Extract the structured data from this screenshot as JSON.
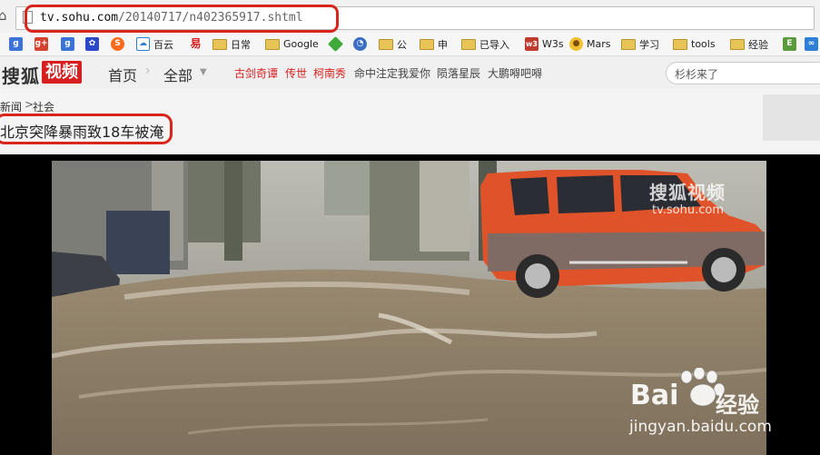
{
  "address_bar": {
    "url_host": "tv.sohu.com",
    "url_path": "/20140717/n402365917.shtml"
  },
  "bookmarks": [
    {
      "icon": "google-blue-icon",
      "label": ""
    },
    {
      "icon": "google-plus-icon",
      "label": ""
    },
    {
      "icon": "google-blue-icon",
      "label": ""
    },
    {
      "icon": "baidu-paw-icon",
      "label": ""
    },
    {
      "icon": "sogou-s-icon",
      "label": ""
    },
    {
      "icon": "baiyun-icon",
      "label": "百云"
    },
    {
      "icon": "yi-red-icon",
      "label": ""
    },
    {
      "icon": "folder-icon",
      "label": "日常"
    },
    {
      "icon": "folder-icon",
      "label": "Google"
    },
    {
      "icon": "green-diamond-icon",
      "label": ""
    },
    {
      "icon": "rss-icon",
      "label": ""
    },
    {
      "icon": "folder-icon",
      "label": "公"
    },
    {
      "icon": "folder-icon",
      "label": "申"
    },
    {
      "icon": "folder-icon",
      "label": "已导入"
    },
    {
      "icon": "w3-icon",
      "label": "W3s"
    },
    {
      "icon": "mars-icon",
      "label": "Mars"
    },
    {
      "icon": "folder-icon",
      "label": "学习"
    },
    {
      "icon": "folder-icon",
      "label": "tools"
    },
    {
      "icon": "folder-icon",
      "label": "经验"
    },
    {
      "icon": "evernote-icon",
      "label": ""
    },
    {
      "icon": "infinity-icon",
      "label": ""
    }
  ],
  "site_header": {
    "logo_text": "搜狐",
    "logo_badge": "视频",
    "nav_home": "首页",
    "nav_all": "全部",
    "hot_links": [
      {
        "text": "古剑奇谭",
        "color": "#d81e1e"
      },
      {
        "text": "传世",
        "color": "#d81e1e"
      },
      {
        "text": "柯南秀",
        "color": "#d81e1e"
      },
      {
        "text": "命中注定我爱你",
        "color": "#444444"
      },
      {
        "text": "陨落星辰",
        "color": "#444444"
      },
      {
        "text": "大鹏嘚吧嘚",
        "color": "#444444"
      }
    ],
    "search_placeholder": "杉杉来了"
  },
  "breadcrumb": {
    "level1": "新闻",
    "separator": ">",
    "level2": "社会"
  },
  "page_title": "北京突降暴雨致18车被淹",
  "video": {
    "watermark_logo": "搜狐视频",
    "watermark_url": "tv.sohu.com"
  },
  "overlay": {
    "baidu_logo": "Bai",
    "baidu_suffix": "经验",
    "baidu_url": "jingyan.baidu.com"
  },
  "colors": {
    "highlight": "#d9251b",
    "sohu_red": "#d81e1e",
    "car": "#e0532a"
  }
}
